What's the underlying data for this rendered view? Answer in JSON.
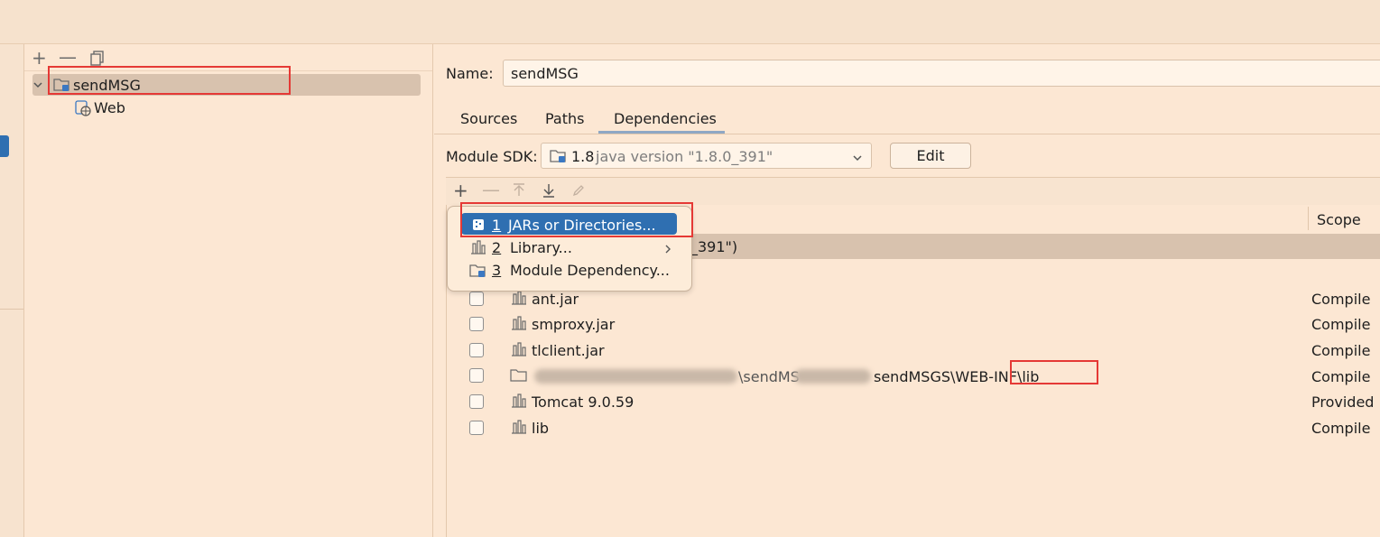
{
  "tree": {
    "toolbar": [
      "add-icon",
      "remove-icon",
      "copy-icon"
    ],
    "root_label": "sendMSG",
    "child_label": "Web"
  },
  "main": {
    "name_label": "Name:",
    "name_value": "sendMSG",
    "tabs": [
      {
        "label": "Sources"
      },
      {
        "label": "Paths"
      },
      {
        "label": "Dependencies"
      }
    ],
    "sdk_label": "Module SDK:",
    "sdk_version": "1.8",
    "sdk_detail": "java version \"1.8.0_391\"",
    "edit_label": "Edit",
    "dep_toolbar": [
      "add-icon",
      "remove-icon",
      "move-up-icon",
      "move-down-icon",
      "edit-icon"
    ],
    "scope_header": "Scope",
    "sdk_row_text": "_391\")",
    "rows": [
      {
        "name": "ant.jar",
        "scope": "Compile"
      },
      {
        "name": "smproxy.jar",
        "scope": "Compile"
      },
      {
        "name": "tlclient.jar",
        "scope": "Compile"
      },
      {
        "name_fragment_1": "\\sendMS",
        "name_fragment_2": "sendMSGS\\WEB-INF\\lib",
        "scope": "Compile"
      },
      {
        "name": "Tomcat 9.0.59",
        "scope": "Provided"
      },
      {
        "name": "lib",
        "scope": "Compile"
      }
    ]
  },
  "popup": {
    "items": [
      {
        "num": "1",
        "label": "JARs or Directories..."
      },
      {
        "num": "2",
        "label": "Library..."
      },
      {
        "num": "3",
        "label": "Module Dependency..."
      }
    ]
  },
  "colors": {
    "background": "#fce7d3",
    "selection": "#2f6fb1",
    "row_selection": "#d8c2ae",
    "highlight_box": "#e53935"
  }
}
